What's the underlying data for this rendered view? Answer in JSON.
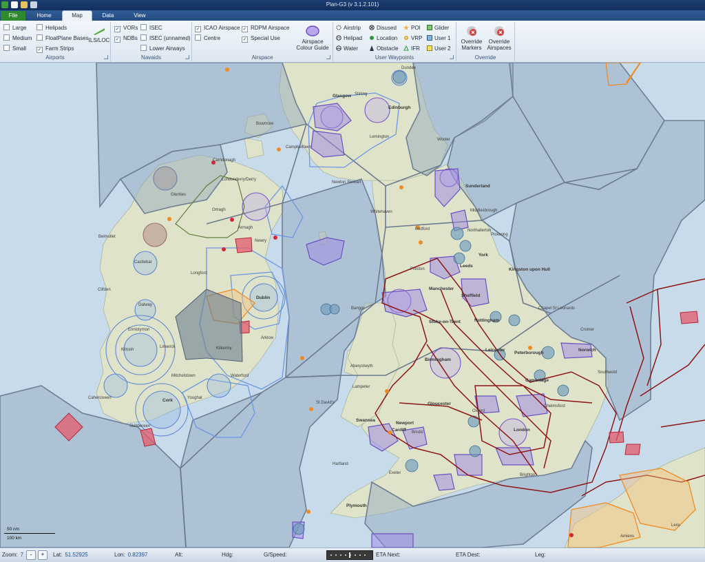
{
  "window": {
    "title": "Plan-G3 (v 3.1.2.101)"
  },
  "tabs": [
    "File",
    "Home",
    "Map",
    "Data",
    "View"
  ],
  "ribbon": {
    "airports": {
      "label": "Airports",
      "large": "Large",
      "medium": "Medium",
      "small": "Small",
      "helipads": "Helipads",
      "floatplane": "FloatPlane Bases",
      "farm": "Farm Strips",
      "ils": "ILS/LOC"
    },
    "navaids": {
      "label": "Navaids",
      "vors": "VORs",
      "ndbs": "NDBs",
      "isec": "ISEC",
      "isec_unnamed": "ISEC (unnamed)",
      "lower_airways": "Lower Airways"
    },
    "airspace": {
      "label": "Airspace",
      "icao": "ICAO Airspace",
      "centre": "Centre",
      "rdpm": "RDPM Airspace",
      "special": "Special Use",
      "guide": "Airspace Colour Guide"
    },
    "waypoints": {
      "label": "User Waypoints",
      "airstrip": "Airstrip",
      "helipad": "Helipad",
      "water": "Water",
      "disused": "Disused",
      "location": "Location",
      "obstacle": "Obstacle",
      "poi": "POI",
      "vrp": "VRP",
      "ifr": "IFR",
      "glider": "Glider",
      "user1": "User 1",
      "user2": "User 2"
    },
    "override": {
      "label": "Override",
      "markers": "Override Markers",
      "airspaces": "Override Airspaces"
    }
  },
  "map": {
    "places": [
      [
        "Dundee",
        false
      ],
      [
        "Edinburgh",
        true
      ],
      [
        "Glasgow",
        true
      ],
      [
        "Stirling",
        false
      ],
      [
        "Campbeltown",
        false
      ],
      [
        "Bowmore",
        false
      ],
      [
        "Lemington",
        false
      ],
      [
        "Wooler",
        false
      ],
      [
        "Carndonagh",
        false
      ],
      [
        "Londonderry/Derry",
        false
      ],
      [
        "Glenties",
        false
      ],
      [
        "Omagh",
        false
      ],
      [
        "Armagh",
        false
      ],
      [
        "Newry",
        false
      ],
      [
        "Belmullet",
        false
      ],
      [
        "Castlebar",
        false
      ],
      [
        "Longford",
        false
      ],
      [
        "Clifden",
        false
      ],
      [
        "Galway",
        false
      ],
      [
        "Dublin",
        true
      ],
      [
        "Ennistymon",
        false
      ],
      [
        "Kilrush",
        false
      ],
      [
        "Limerick",
        false
      ],
      [
        "Kilkenny",
        false
      ],
      [
        "Arklow",
        false
      ],
      [
        "Mitchelstown",
        false
      ],
      [
        "Waterford",
        false
      ],
      [
        "Cork",
        true
      ],
      [
        "Youghal",
        false
      ],
      [
        "Caherciveen",
        false
      ],
      [
        "Skibbereen",
        false
      ],
      [
        "Newton Stewart",
        false
      ],
      [
        "Sunderland",
        true
      ],
      [
        "Middlesbrough",
        false
      ],
      [
        "Whitehaven",
        false
      ],
      [
        "Bedford",
        false
      ],
      [
        "Northallerton",
        false
      ],
      [
        "Pickering",
        false
      ],
      [
        "York",
        true
      ],
      [
        "Leeds",
        true
      ],
      [
        "Preston",
        false
      ],
      [
        "Kingston upon Hull",
        true
      ],
      [
        "Manchester",
        true
      ],
      [
        "Sheffield",
        true
      ],
      [
        "Chapel St Leonards",
        false
      ],
      [
        "Bangor",
        false
      ],
      [
        "Nottingham",
        true
      ],
      [
        "Stoke-on-Trent",
        true
      ],
      [
        "Cromer",
        false
      ],
      [
        "Leicester",
        true
      ],
      [
        "Peterborough",
        true
      ],
      [
        "Norwich",
        true
      ],
      [
        "Birmingham",
        true
      ],
      [
        "Aberystwyth",
        false
      ],
      [
        "Cambridge",
        true
      ],
      [
        "Southwold",
        false
      ],
      [
        "Lampeter",
        false
      ],
      [
        "St David's",
        false
      ],
      [
        "Gloucester",
        true
      ],
      [
        "Oxford",
        false
      ],
      [
        "Chelmsford",
        false
      ],
      [
        "Swansea",
        true
      ],
      [
        "Newport",
        true
      ],
      [
        "Cardiff",
        true
      ],
      [
        "Bristol",
        false
      ],
      [
        "London",
        true
      ],
      [
        "Hartland",
        false
      ],
      [
        "Exeter",
        false
      ],
      [
        "Brighton",
        false
      ],
      [
        "Plymouth",
        true
      ],
      [
        "Amiens",
        false
      ],
      [
        "Lens",
        false
      ]
    ]
  },
  "scale": {
    "top": "50 nm",
    "bottom": "100 km"
  },
  "status": {
    "zoom_label": "Zoom:",
    "zoom": "7",
    "minus": "-",
    "plus": "+",
    "lat_label": "Lat:",
    "lat": "51.52925",
    "lon_label": "Lon:",
    "lon": "0.82397",
    "alt_label": "Alt:",
    "hdg_label": "Hdg:",
    "gspeed_label": "G/Speed:",
    "eta_next_label": "ETA Next:",
    "eta_dest_label": "ETA Dest:",
    "leg_label": "Leg:"
  },
  "colors": {
    "ocean": "#c8dbea",
    "land": "#dfe3c9",
    "fir": "#6e7f95",
    "icao": "#5f86d6",
    "rdpm": "#7a55c9",
    "tma": "#8e1414",
    "special": "#d64a5a",
    "orange": "#f08a23"
  }
}
